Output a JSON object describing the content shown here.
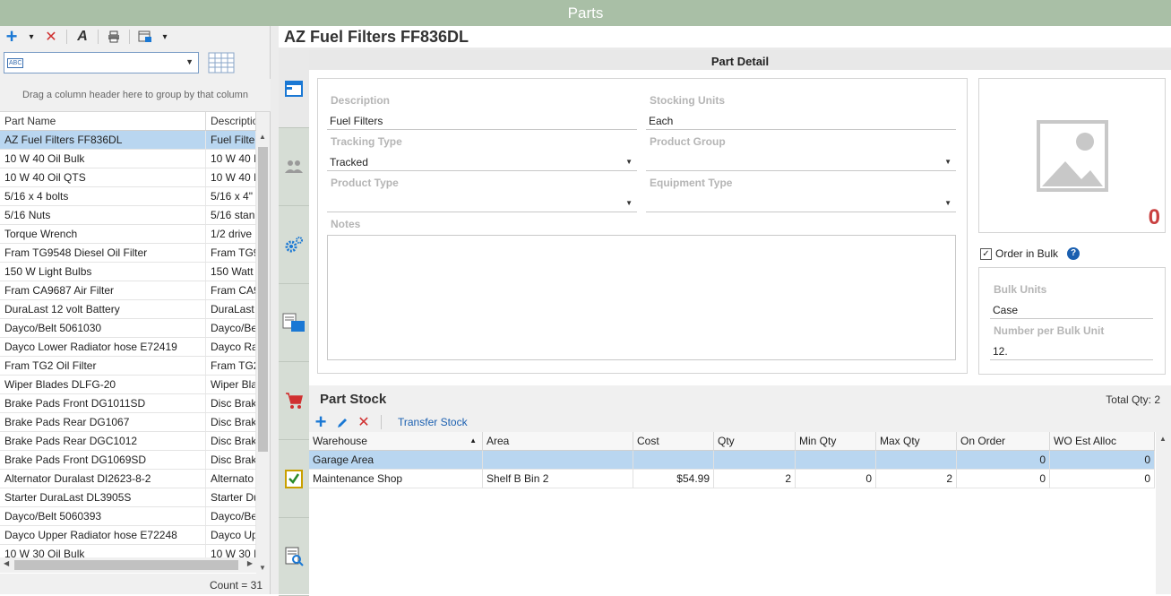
{
  "window": {
    "title": "Parts"
  },
  "left": {
    "toolbar": {
      "add": "+",
      "add_dd": "▾",
      "delete": "✕",
      "spell": "A",
      "print": "🖶",
      "layout": "▦",
      "layout_dd": "▾"
    },
    "filter": {
      "value": "",
      "abc": "ABC"
    },
    "group_hint": "Drag a column header here to group by that column",
    "columns": [
      "Part Name",
      "Description"
    ],
    "rows": [
      [
        "AZ Fuel Filters FF836DL",
        "Fuel Filter"
      ],
      [
        "10 W 40 Oil Bulk",
        "10 W 40 I"
      ],
      [
        "10 W 40 Oil QTS",
        "10 W 40 I"
      ],
      [
        "5/16 x 4 bolts",
        "5/16 x 4\""
      ],
      [
        "5/16 Nuts",
        "5/16 stan"
      ],
      [
        "Torque Wrench",
        "1/2 drive"
      ],
      [
        "Fram TG9548 Diesel Oil Filter",
        "Fram TG9"
      ],
      [
        "150 W Light Bulbs",
        "150 Watt"
      ],
      [
        "Fram CA9687 Air Filter",
        "Fram CA9"
      ],
      [
        "DuraLast 12 volt Battery",
        "DuraLast"
      ],
      [
        "Dayco/Belt 5061030",
        "Dayco/Be"
      ],
      [
        "Dayco Lower Radiator hose E72419",
        "Dayco Ra"
      ],
      [
        "Fram TG2 Oil Filter",
        "Fram TG2"
      ],
      [
        "Wiper Blades DLFG-20",
        "Wiper Bla"
      ],
      [
        "Brake Pads Front DG1011SD",
        "Disc Brak"
      ],
      [
        "Brake Pads Rear DG1067",
        "Disc Brak"
      ],
      [
        "Brake Pads Rear DGC1012",
        "Disc Brak"
      ],
      [
        "Brake Pads Front DG1069SD",
        "Disc Brak"
      ],
      [
        "Alternator Duralast DI2623-8-2",
        "Alternato"
      ],
      [
        "Starter DuraLast DL3905S",
        "Starter Du"
      ],
      [
        "Dayco/Belt 5060393",
        "Dayco/Be"
      ],
      [
        "Dayco Upper Radiator hose E72248",
        "Dayco Up"
      ],
      [
        "10 W 30 Oil Bulk",
        "10 W 30 I"
      ]
    ],
    "count_label": "Count = 31"
  },
  "detail": {
    "title": "AZ Fuel Filters FF836DL",
    "section": "Part Detail",
    "fields": {
      "description": {
        "label": "Description",
        "value": "Fuel Filters"
      },
      "stocking_units": {
        "label": "Stocking Units",
        "value": "Each"
      },
      "tracking_type": {
        "label": "Tracking Type",
        "value": "Tracked"
      },
      "product_group": {
        "label": "Product Group",
        "value": ""
      },
      "product_type": {
        "label": "Product Type",
        "value": ""
      },
      "equipment_type": {
        "label": "Equipment Type",
        "value": ""
      },
      "notes": {
        "label": "Notes",
        "value": ""
      }
    },
    "image_count": "0",
    "order_in_bulk": {
      "label": "Order in Bulk",
      "checked": true
    },
    "bulk_units": {
      "label": "Bulk Units",
      "value": "Case"
    },
    "number_per_bulk": {
      "label": "Number per Bulk Unit",
      "value": "12."
    }
  },
  "stock": {
    "title": "Part Stock",
    "total_label": "Total Qty:",
    "total_value": "2",
    "transfer_label": "Transfer Stock",
    "columns": [
      "Warehouse",
      "Area",
      "Cost",
      "Qty",
      "Min Qty",
      "Max Qty",
      "On Order",
      "WO Est Alloc"
    ],
    "rows": [
      [
        "Garage Area",
        "",
        "",
        "",
        "",
        "",
        "0",
        "0"
      ],
      [
        "Maintenance Shop",
        "Shelf B Bin 2",
        "$54.99",
        "2",
        "0",
        "2",
        "0",
        "0"
      ]
    ]
  },
  "colors": {
    "titlebar": "#a9bfa6",
    "accent": "#1a78d4",
    "delete": "#d03030",
    "selected_row": "#b9d6f0"
  }
}
